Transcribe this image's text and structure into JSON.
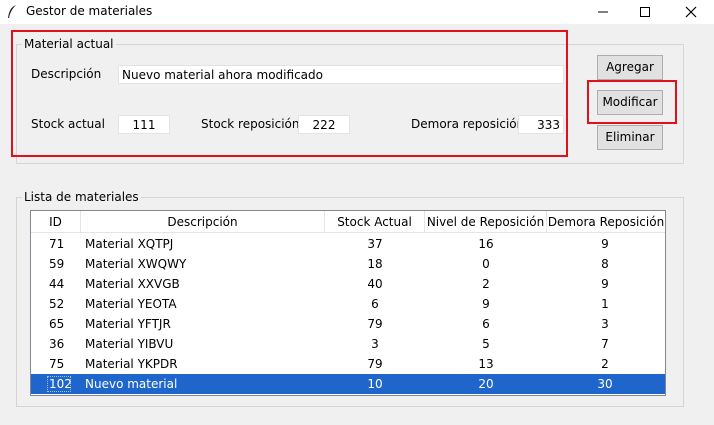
{
  "window": {
    "title": "Gestor de materiales"
  },
  "current": {
    "group_label": "Material actual",
    "desc_label": "Descripción",
    "desc_value": "Nuevo material ahora modificado",
    "stock_label": "Stock actual",
    "stock_value": "111",
    "repo_label": "Stock reposición",
    "repo_value": "222",
    "demora_label": "Demora reposición",
    "demora_value": "333"
  },
  "buttons": {
    "add": "Agregar",
    "modify": "Modificar",
    "delete": "Eliminar"
  },
  "list": {
    "group_label": "Lista de materiales",
    "columns": [
      "ID",
      "Descripción",
      "Stock Actual",
      "Nivel de Reposición",
      "Demora Reposición"
    ],
    "rows": [
      {
        "id": "71",
        "desc": "Material XQTPJ",
        "stock": "37",
        "nivel": "16",
        "demora": "9"
      },
      {
        "id": "59",
        "desc": "Material XWQWY",
        "stock": "18",
        "nivel": "0",
        "demora": "8"
      },
      {
        "id": "44",
        "desc": "Material XXVGB",
        "stock": "40",
        "nivel": "2",
        "demora": "9"
      },
      {
        "id": "52",
        "desc": "Material YEOTA",
        "stock": "6",
        "nivel": "9",
        "demora": "1"
      },
      {
        "id": "65",
        "desc": "Material YFTJR",
        "stock": "79",
        "nivel": "6",
        "demora": "3"
      },
      {
        "id": "36",
        "desc": "Material YIBVU",
        "stock": "3",
        "nivel": "5",
        "demora": "7"
      },
      {
        "id": "75",
        "desc": "Material YKPDR",
        "stock": "79",
        "nivel": "13",
        "demora": "2"
      },
      {
        "id": "102",
        "desc": "Nuevo material",
        "stock": "10",
        "nivel": "20",
        "demora": "30",
        "selected": true
      }
    ]
  },
  "colors": {
    "highlight": "#e0111b",
    "selection": "#1f66cc"
  },
  "icons": {
    "app": "feather-icon",
    "minimize": "minimize-icon",
    "maximize": "maximize-icon",
    "close": "close-icon"
  }
}
